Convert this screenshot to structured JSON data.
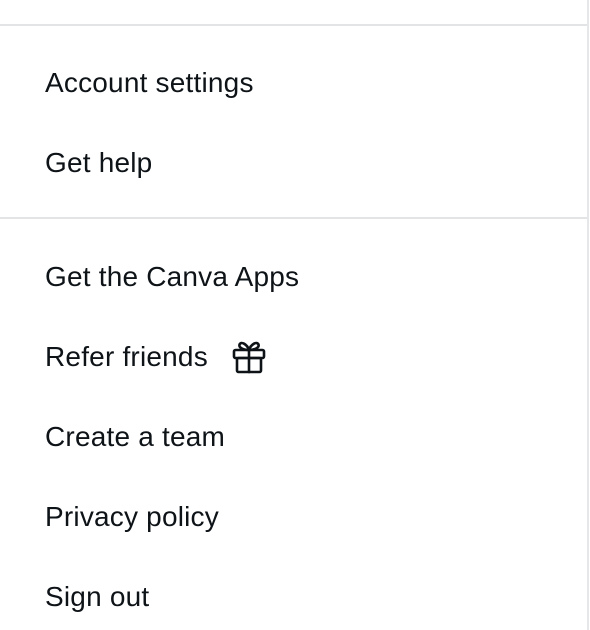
{
  "menu": {
    "section_account": {
      "account_settings": "Account settings",
      "get_help": "Get help"
    },
    "section_more": {
      "get_apps": "Get the Canva Apps",
      "refer_friends": "Refer friends",
      "create_team": "Create a team",
      "privacy_policy": "Privacy policy",
      "sign_out": "Sign out"
    },
    "icons": {
      "refer_friends_icon": "gift-icon"
    }
  }
}
